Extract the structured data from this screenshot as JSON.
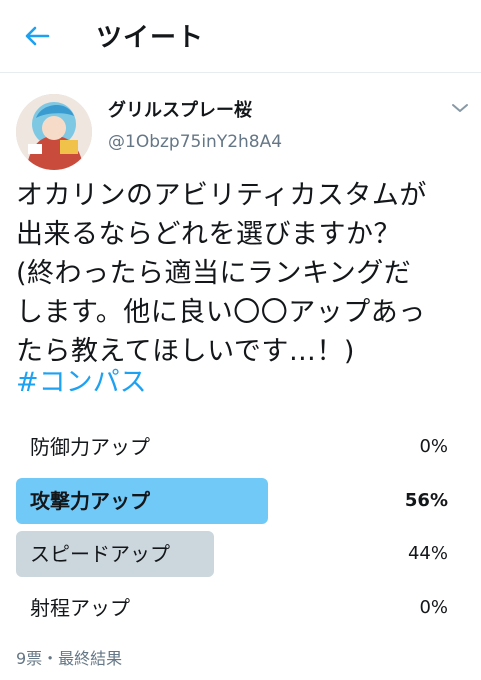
{
  "header": {
    "title": "ツイート",
    "back_icon": "arrow-left-icon",
    "accent_color": "#1da1f2"
  },
  "user": {
    "display_name": "グリルスプレー桜",
    "handle": "@1Obzp75inY2h8A4"
  },
  "tweet": {
    "text": "オカリンのアビリティカスタムが\n出来るならどれを選びますか？\n(終わったら適当にランキングだ\nします。他に良い〇〇アップあっ\nたら教えてほしいです…！)",
    "hashtag": "#コンパス"
  },
  "poll": {
    "options": [
      {
        "label": "防御力アップ",
        "percent_text": "0%",
        "fraction": 0.0,
        "winner": false
      },
      {
        "label": "攻撃力アップ",
        "percent_text": "56%",
        "fraction": 0.56,
        "winner": true
      },
      {
        "label": "スピードアップ",
        "percent_text": "44%",
        "fraction": 0.44,
        "winner": false
      },
      {
        "label": "射程アップ",
        "percent_text": "0%",
        "fraction": 0.0,
        "winner": false
      }
    ],
    "footer": "9票・最終結果",
    "winner_color": "#71c9f8",
    "loser_color": "#ccd6dd"
  }
}
